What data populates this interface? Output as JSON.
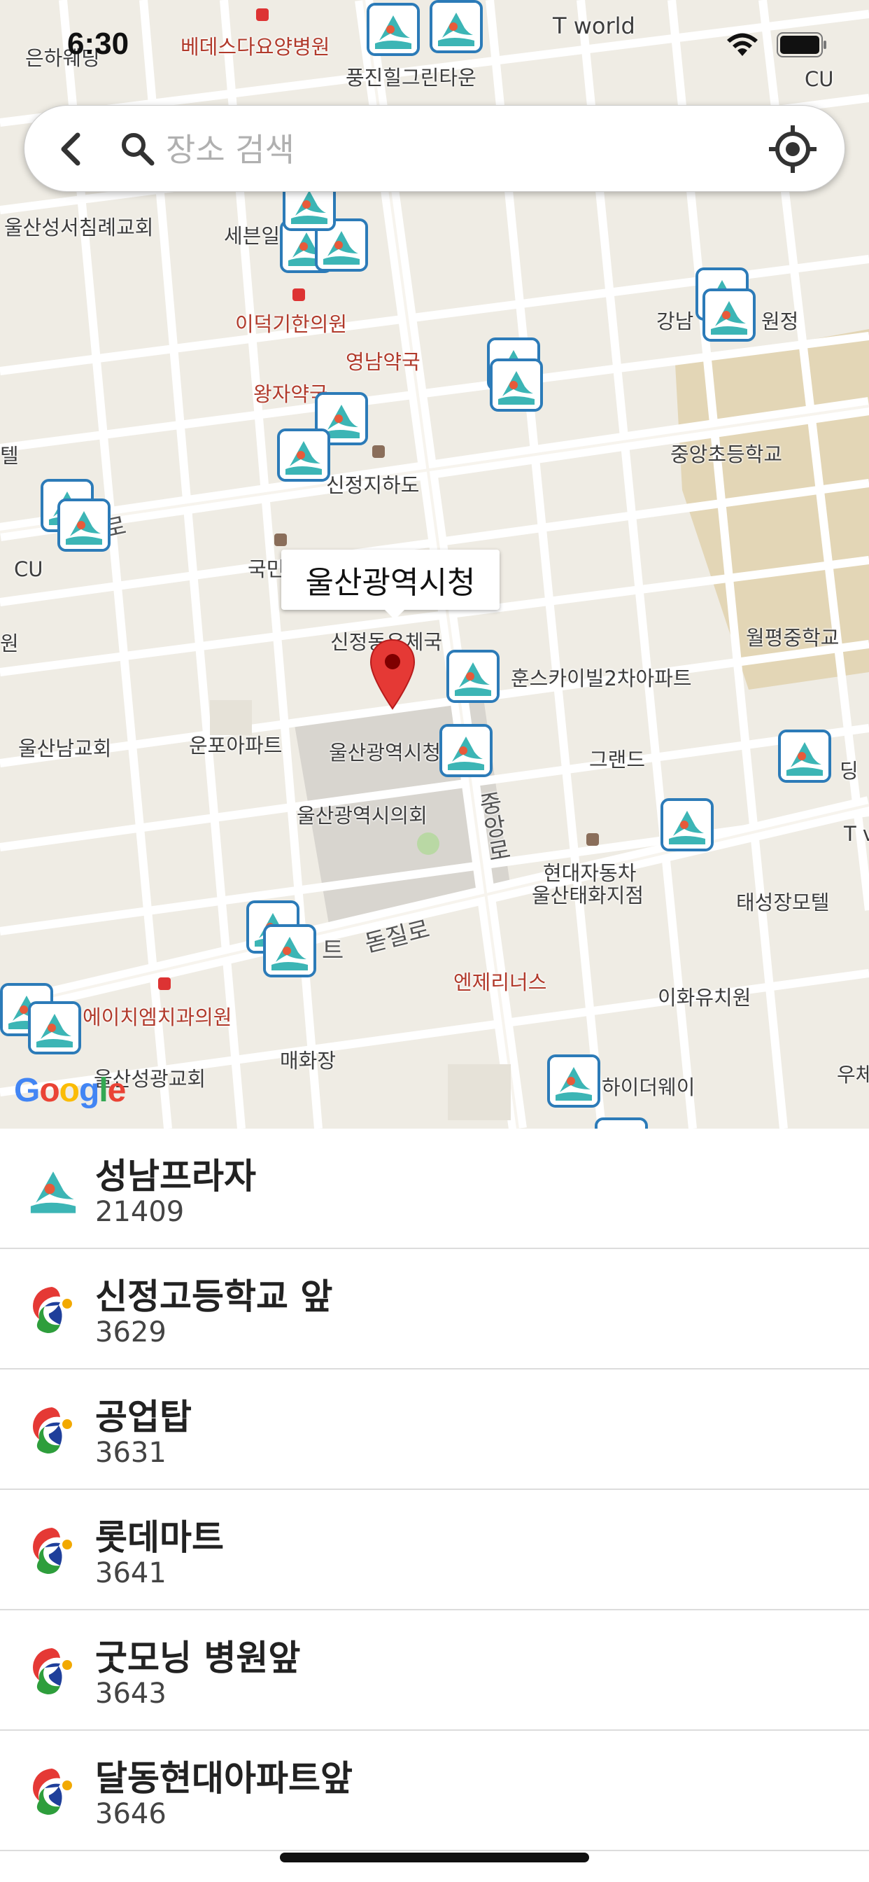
{
  "status_bar": {
    "time": "6:30"
  },
  "search": {
    "placeholder": "장소 검색",
    "value": ""
  },
  "map": {
    "callout_title": "울산광역시청",
    "attribution": "Google",
    "labels": {
      "eunhaengsa": "은하웨딩",
      "bethesda": "베데스다요양병원",
      "tworld": "T world",
      "pungjin": "풍진힐그린타운",
      "cu_top": "CU",
      "church": "울산성서침례교회",
      "sebun": "세븐일",
      "leedeoggi": "이덕기한의원",
      "yeongnam": "영남약국",
      "wangja": "왕자약국",
      "sinjeong_under": "신정지하도",
      "gangnam": "강남",
      "wonjeong": "원정",
      "jungang_elem": "중앙초등학교",
      "cu_left": "CU",
      "gukmin": "국민",
      "sinjeong_post": "신정동우체국",
      "wolpyeong": "월평중학교",
      "hunseu": "훈스카이빌2차아파트",
      "ulsan_nam_church": "울산남교회",
      "unpo": "운포아파트",
      "cityhall": "울산광역시청",
      "grand": "그랜드",
      "council": "울산광역시의회",
      "jungang_ro": "중앙로",
      "hyundai": "현대자동차",
      "hyundai_branch": "울산태화지점",
      "taeseong": "태성장모텔",
      "dondil": "돋질로",
      "apt": "트",
      "enjeri": "엔제리너스",
      "ewha": "이화유치원",
      "hchi": "에이치엠치과의원",
      "maehwa": "매화장",
      "seonggwang": "울산성광교회",
      "highway": "하이더웨이",
      "dingl": "딩",
      "tv": "T v",
      "usu": "우체",
      "ro": "로",
      "tel": "텔",
      "won": "원"
    }
  },
  "stations": [
    {
      "name": "성남프라자",
      "id": "21409",
      "type": "bike"
    },
    {
      "name": "신정고등학교 앞",
      "id": "3629",
      "type": "bus"
    },
    {
      "name": "공업탑",
      "id": "3631",
      "type": "bus"
    },
    {
      "name": "롯데마트",
      "id": "3641",
      "type": "bus"
    },
    {
      "name": "굿모닝 병원앞",
      "id": "3643",
      "type": "bus"
    },
    {
      "name": "달동현대아파트앞",
      "id": "3646",
      "type": "bus"
    }
  ],
  "icons": {
    "back": "chevron-left-icon",
    "search": "search-icon",
    "locate": "locate-icon",
    "marker": "station-marker-icon",
    "pin": "map-pin-icon"
  },
  "colors": {
    "marker_border": "#2c7bb8",
    "marker_wave": "#3cb5b5",
    "pin": "#e53935",
    "map_bg": "#efece4",
    "road": "#ffffff",
    "park": "#e3d6b6"
  }
}
